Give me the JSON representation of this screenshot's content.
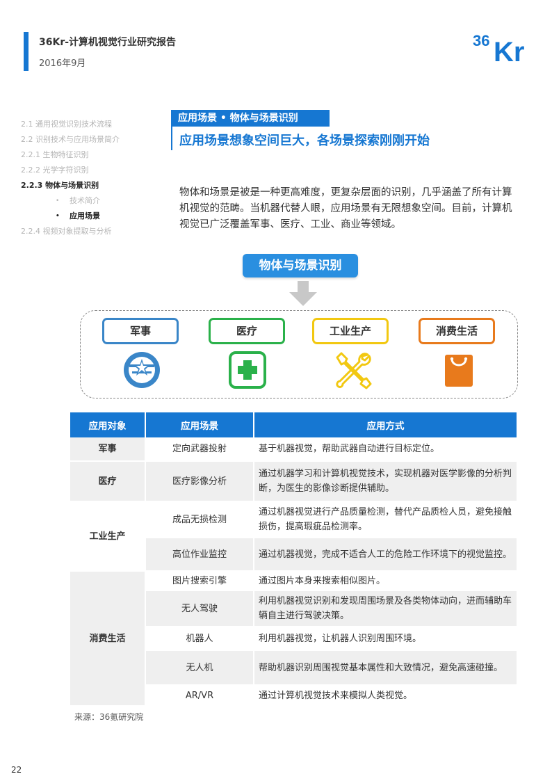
{
  "header": {
    "title": "36Kr-计算机视觉行业研究报告",
    "date": "2016年9月",
    "logo_text": "36Kr",
    "accent_color": "#1677d2"
  },
  "toc": [
    {
      "label": "2.1 通用视觉识别技术流程",
      "active": false
    },
    {
      "label": "2.2 识别技术与应用场景简介",
      "active": false
    },
    {
      "label": "2.2.1 生物特征识别",
      "active": false
    },
    {
      "label": "2.2.2 光学字符识别",
      "active": false
    },
    {
      "label": "2.2.3 物体与场景识别",
      "active": true
    },
    {
      "label": "技术简介",
      "active": false,
      "sub": true
    },
    {
      "label": "应用场景",
      "active": true,
      "sub": true
    },
    {
      "label": "2.2.4 视频对象提取与分析",
      "active": false
    }
  ],
  "section": {
    "tag": "应用场景 • 物体与场景识别",
    "title": "应用场景想象空间巨大，各场景探索刚刚开始",
    "intro": "物体和场景是被是一种更高难度，更复杂层面的识别，几乎涵盖了所有计算机视觉的范畴。当机器代替人眼，应用场景有无限想象空间。目前，计算机视觉已广泛覆盖军事、医疗、工业、商业等领域。"
  },
  "diagram": {
    "title": "物体与场景识别",
    "categories": [
      {
        "label": "军事",
        "color": "#3a86c8",
        "icon": "military-badge-icon"
      },
      {
        "label": "医疗",
        "color": "#2ab14a",
        "icon": "medical-cross-icon"
      },
      {
        "label": "工业生产",
        "color": "#f2c811",
        "icon": "tools-icon"
      },
      {
        "label": "消费生活",
        "color": "#e87a1c",
        "icon": "shopping-bag-icon"
      }
    ]
  },
  "table": {
    "headers": [
      "应用对象",
      "应用场景",
      "应用方式"
    ],
    "groups": [
      {
        "object": "军事",
        "rows": [
          {
            "scene": "定向武器投射",
            "way": "基于机器视觉，帮助武器自动进行目标定位。"
          }
        ]
      },
      {
        "object": "医疗",
        "rows": [
          {
            "scene": "医疗影像分析",
            "way": "通过机器学习和计算机视觉技术，实现机器对医学影像的分析判断，为医生的影像诊断提供辅助。"
          }
        ]
      },
      {
        "object": "工业生产",
        "rows": [
          {
            "scene": "成品无损检测",
            "way": "通过机器视觉进行产品质量检测，替代产品质检人员，避免接触损伤，提高瑕疵品检测率。"
          },
          {
            "scene": "高位作业监控",
            "way": "通过机器视觉，完成不适合人工的危险工作环境下的视觉监控。"
          }
        ]
      },
      {
        "object": "消费生活",
        "rows": [
          {
            "scene": "图片搜索引擎",
            "way": "通过图片本身来搜索相似图片。"
          },
          {
            "scene": "无人驾驶",
            "way": "利用机器视觉识别和发现周围场景及各类物体动向，进而辅助车辆自主进行驾驶决策。"
          },
          {
            "scene": "机器人",
            "way": "利用机器视觉，让机器人识别周围环境。"
          },
          {
            "scene": "无人机",
            "way": "帮助机器识别周围视觉基本属性和大致情况，避免高速碰撞。"
          },
          {
            "scene": "AR/VR",
            "way": "通过计算机视觉技术来模拟人类视觉。"
          }
        ]
      }
    ]
  },
  "source": "来源：36氪研究院",
  "page_number": "22"
}
